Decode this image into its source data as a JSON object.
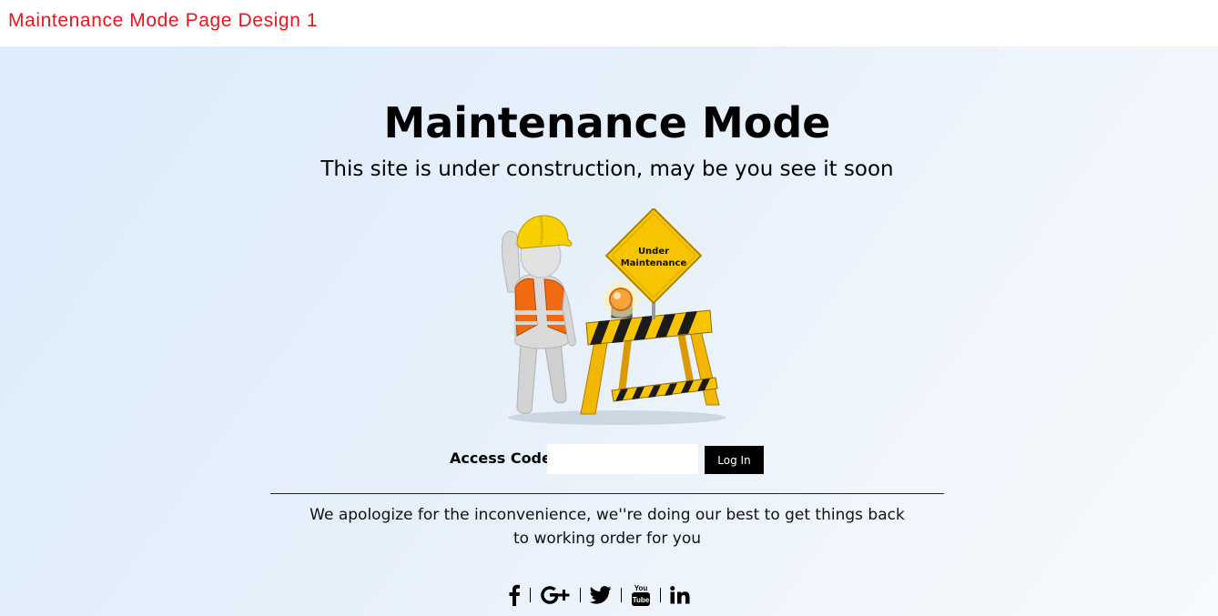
{
  "header": {
    "page_heading": "Maintenance Mode Page Design 1",
    "heading_color": "#e8161b"
  },
  "hero": {
    "title": "Maintenance Mode",
    "subtitle": "This site is under construction, may be you see it soon"
  },
  "illustration": {
    "sign_line1": "Under",
    "sign_line2": "Maintenance"
  },
  "login": {
    "label": "Access Code:",
    "input_value": "",
    "button_label": "Log In"
  },
  "message": {
    "line1": "We apologize for the inconvenience, we''re doing our best to get things back",
    "line2": "to working order for you"
  },
  "social": [
    {
      "name": "facebook-icon"
    },
    {
      "name": "google-plus-icon"
    },
    {
      "name": "twitter-icon"
    },
    {
      "name": "youtube-icon"
    },
    {
      "name": "linkedin-icon"
    }
  ],
  "colors": {
    "background_start": "#dcecfb",
    "background_end": "#f6f9fd",
    "button_bg": "#000000"
  }
}
